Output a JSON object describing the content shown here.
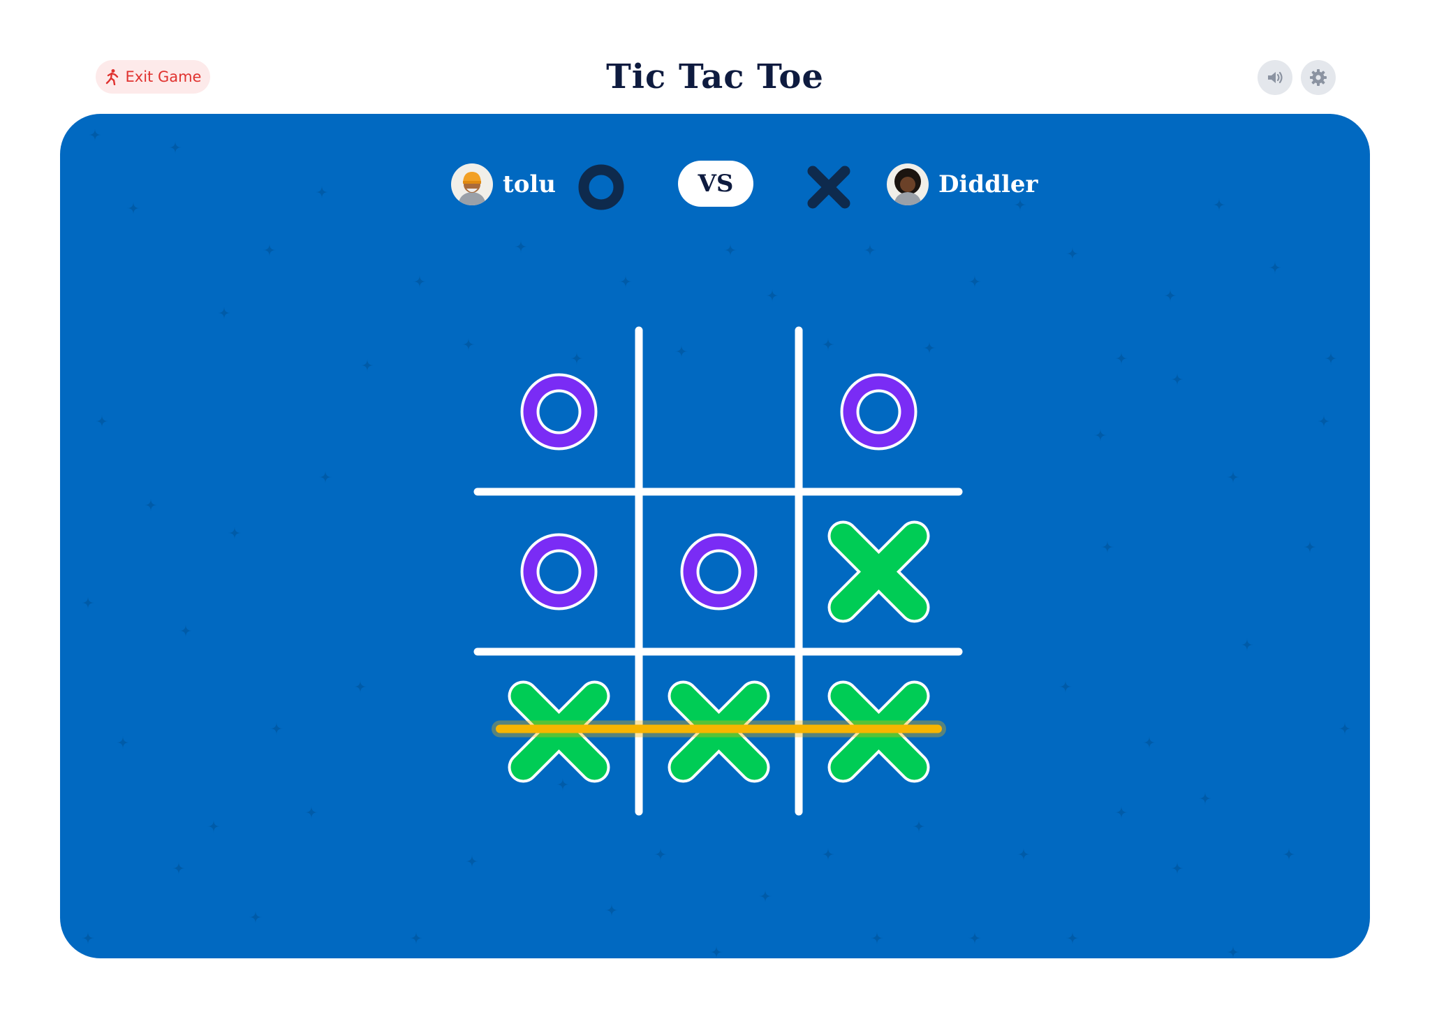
{
  "header": {
    "exit_label": "Exit Game",
    "title": "Tic Tac Toe",
    "sound_icon": "speaker-icon",
    "settings_icon": "gear-icon"
  },
  "players": [
    {
      "name": "tolu",
      "mark": "O",
      "mark_color": "#0e2a4d"
    },
    {
      "name": "Diddler",
      "mark": "X",
      "mark_color": "#0e2a4d"
    }
  ],
  "vs_label": "VS",
  "board": [
    [
      "O",
      "",
      "O"
    ],
    [
      "O",
      "O",
      "X"
    ],
    [
      "X",
      "X",
      "X"
    ]
  ],
  "winning_line": {
    "row": 2
  },
  "colors": {
    "background": "#0169c1",
    "o_mark": "#7a2cf5",
    "x_mark": "#00cc55",
    "win_line": "#f7b500",
    "exit": "#e0322f"
  }
}
